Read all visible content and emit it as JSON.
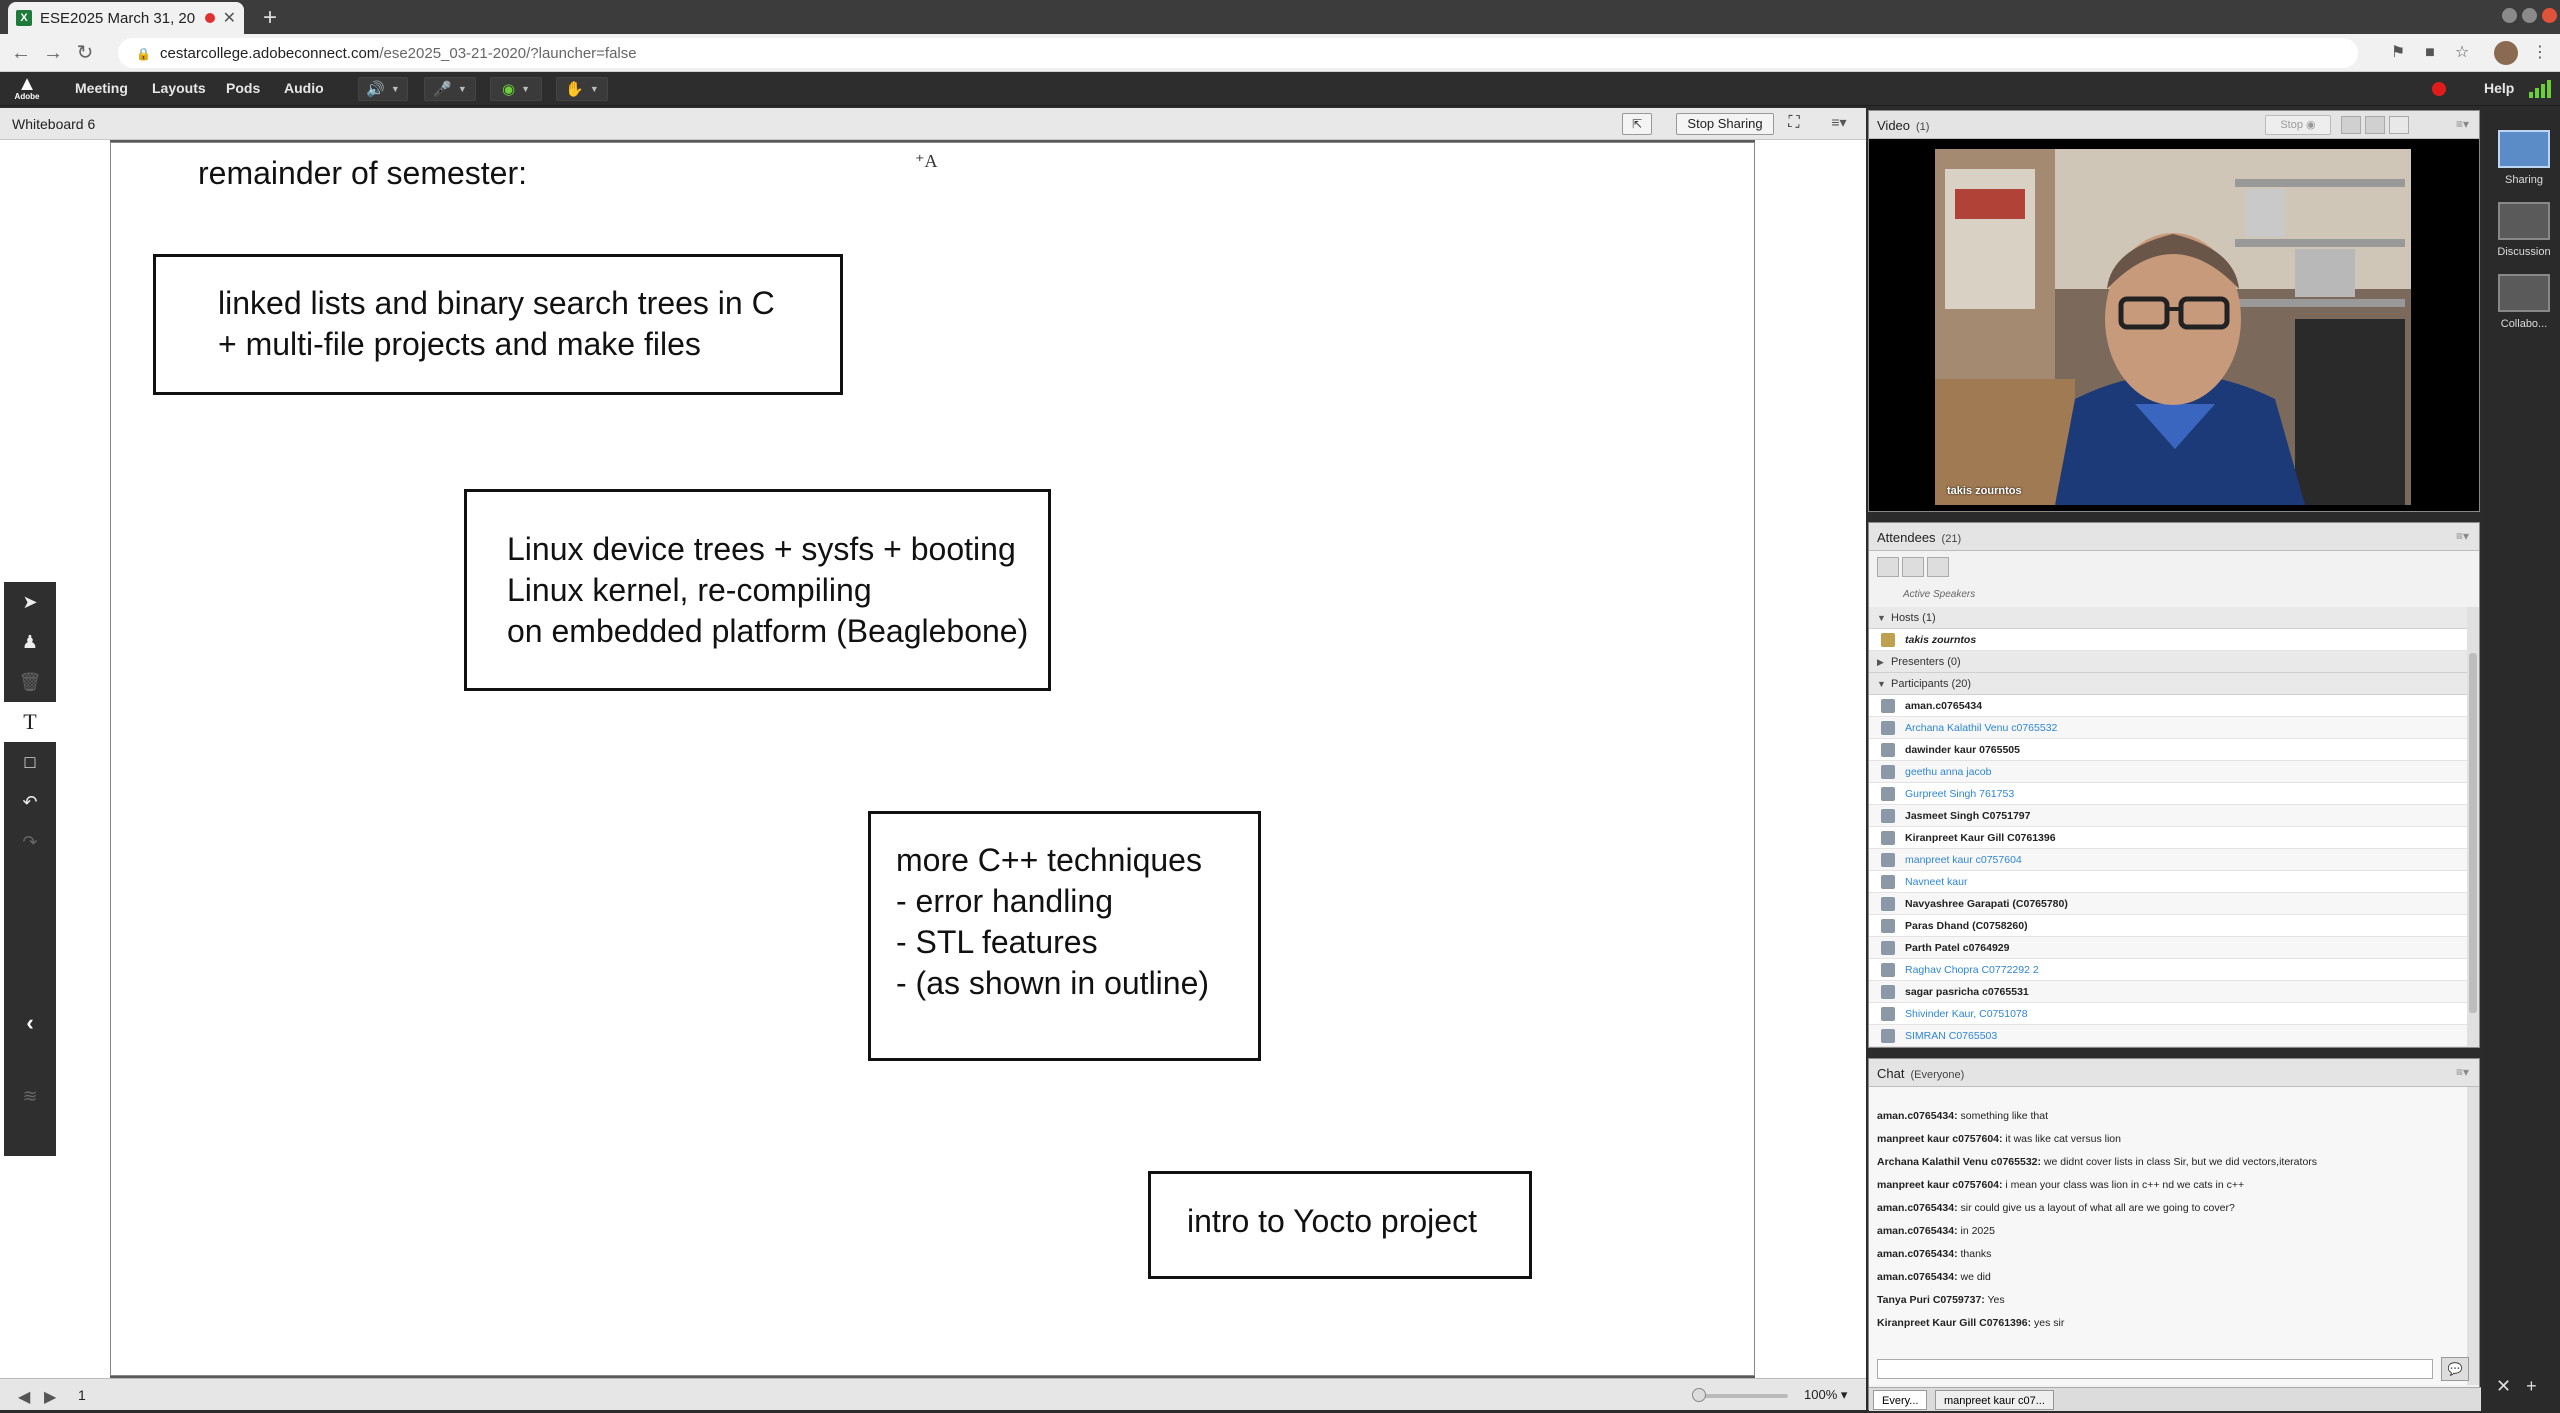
{
  "browser": {
    "tab_title": "ESE2025 March 31, 20",
    "tab_favicon": "X",
    "url_host": "cestarcollege.adobeconnect.com",
    "url_path": "/ese2025_03-21-2020/?launcher=false"
  },
  "menubar": {
    "logo_text": "Adobe",
    "items": [
      "Meeting",
      "Layouts",
      "Pods",
      "Audio"
    ],
    "help_label": "Help"
  },
  "whiteboard": {
    "title": "Whiteboard 6",
    "stop_sharing_label": "Stop Sharing",
    "heading": "remainder of semester:",
    "boxes": [
      {
        "text": "linked lists and binary search trees in C\n+ multi-file projects and make files"
      },
      {
        "text": "Linux device trees + sysfs + booting\nLinux kernel, re-compiling\non embedded platform (Beaglebone)"
      },
      {
        "text": "more C++ techniques\n- error handling\n- STL features\n- (as shown in outline)"
      },
      {
        "text": "intro to Yocto project"
      }
    ],
    "page_number": "1",
    "zoom": "100%"
  },
  "video": {
    "title": "Video",
    "count": "(1)",
    "stop_label": "Stop",
    "presenter_name": "takis zourntos"
  },
  "attendees": {
    "title": "Attendees",
    "count": "(21)",
    "active_speakers_label": "Active Speakers",
    "hosts_label": "Hosts (1)",
    "host_name": "takis zourntos",
    "presenters_label": "Presenters (0)",
    "participants_label": "Participants (20)",
    "participants": [
      {
        "name": "aman.c0765434",
        "highlight": false
      },
      {
        "name": "Archana Kalathil Venu c0765532",
        "highlight": true
      },
      {
        "name": "dawinder kaur 0765505",
        "highlight": false
      },
      {
        "name": "geethu anna jacob",
        "highlight": true
      },
      {
        "name": "Gurpreet Singh 761753",
        "highlight": true
      },
      {
        "name": "Jasmeet Singh C0751797",
        "highlight": false
      },
      {
        "name": "Kiranpreet Kaur Gill C0761396",
        "highlight": false
      },
      {
        "name": "manpreet kaur c0757604",
        "highlight": true
      },
      {
        "name": "Navneet kaur",
        "highlight": true
      },
      {
        "name": "Navyashree Garapati (C0765780)",
        "highlight": false
      },
      {
        "name": "Paras Dhand (C0758260)",
        "highlight": false
      },
      {
        "name": "Parth Patel c0764929",
        "highlight": false
      },
      {
        "name": "Raghav Chopra C0772292 2",
        "highlight": true
      },
      {
        "name": "sagar pasricha c0765531",
        "highlight": false
      },
      {
        "name": "Shivinder Kaur, C0751078",
        "highlight": true
      },
      {
        "name": "SIMRAN C0765503",
        "highlight": true
      }
    ]
  },
  "chat": {
    "title": "Chat",
    "scope": "(Everyone)",
    "messages": [
      {
        "sender": "aman.c0765434:",
        "text": " something like that"
      },
      {
        "sender": "manpreet kaur c0757604:",
        "text": " it was like cat versus lion"
      },
      {
        "sender": "Archana Kalathil Venu c0765532:",
        "text": " we didnt cover lists in class Sir, but we did vectors,iterators"
      },
      {
        "sender": "manpreet kaur c0757604:",
        "text": " i mean your class was lion in c++ nd we cats in c++"
      },
      {
        "sender": "aman.c0765434:",
        "text": " sir could give us a layout of what all are we going to cover?"
      },
      {
        "sender": "aman.c0765434:",
        "text": " in 2025"
      },
      {
        "sender": "aman.c0765434:",
        "text": " thanks"
      },
      {
        "sender": "aman.c0765434:",
        "text": " we did"
      },
      {
        "sender": "Tanya Puri C0759737:",
        "text": " Yes"
      },
      {
        "sender": "Kiranpreet Kaur Gill C0761396:",
        "text": " yes sir"
      }
    ],
    "tabs": [
      "Every...",
      "manpreet kaur c07..."
    ]
  },
  "layouts": {
    "items": [
      "Sharing",
      "Discussion",
      "Collabo..."
    ]
  },
  "colors": {
    "accent_green": "#6ccf3a",
    "record_red": "#e01b1b",
    "attendee_link_blue": "#2d86d6",
    "layout_selected": "#5b8cc7"
  }
}
